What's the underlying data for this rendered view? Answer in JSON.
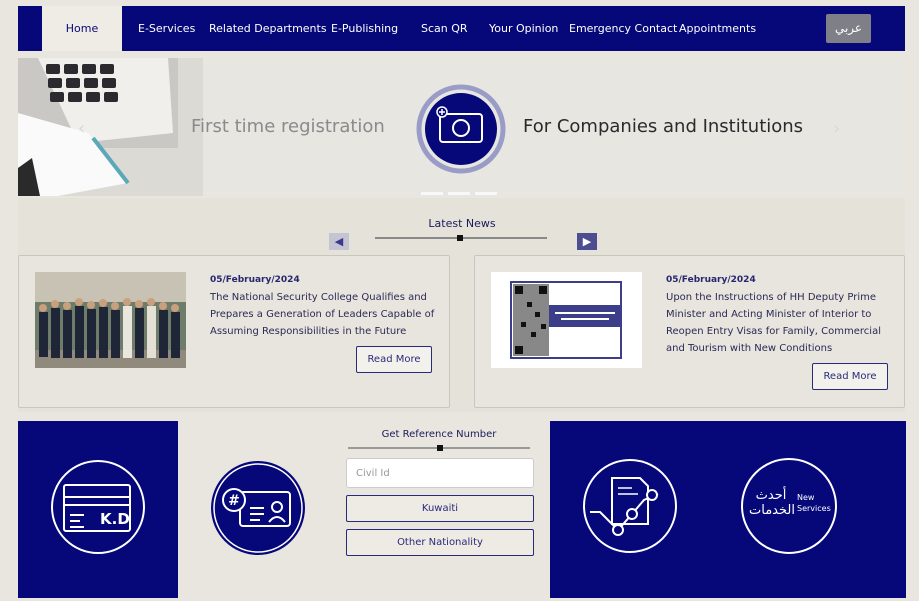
{
  "nav": {
    "items": [
      {
        "label": "Home",
        "active": true
      },
      {
        "label": "E-Services"
      },
      {
        "label": "Related Departments"
      },
      {
        "label": "E-Publishing"
      },
      {
        "label": "Scan QR"
      },
      {
        "label": "Your Opinion"
      },
      {
        "label": "Emergency Contact"
      },
      {
        "label": "Appointments"
      }
    ],
    "lang_label": "عربي"
  },
  "banner": {
    "left_text": "First time registration",
    "right_text": "For Companies and Institutions",
    "prev_arrow": "‹",
    "next_arrow": "›"
  },
  "news": {
    "title": "Latest News",
    "prev": "◀",
    "next": "▶",
    "cards": [
      {
        "date": "05/February/2024",
        "text": "The National Security College Qualifies and Prepares a Generation of Leaders Capable of Assuming Responsibilities in the Future",
        "read_more": "Read More"
      },
      {
        "date": "05/February/2024",
        "text": "Upon the Instructions of HH Deputy Prime Minister and Acting Minister of Interior to Reopen Entry Visas for Family, Commercial and Tourism with New Conditions",
        "read_more": "Read More"
      }
    ]
  },
  "services": {
    "kd_label": "K.D",
    "newest_ar": "أحدث الخدمات",
    "newest_en_1": "New",
    "newest_en_2": "Services"
  },
  "reference": {
    "title": "Get Reference Number",
    "civil_placeholder": "Civil Id",
    "kuwaiti_label": "Kuwaiti",
    "other_label": "Other Nationality"
  },
  "colors": {
    "navy": "#06087a",
    "background": "#e9e6df",
    "lang_button": "#7f8087"
  }
}
